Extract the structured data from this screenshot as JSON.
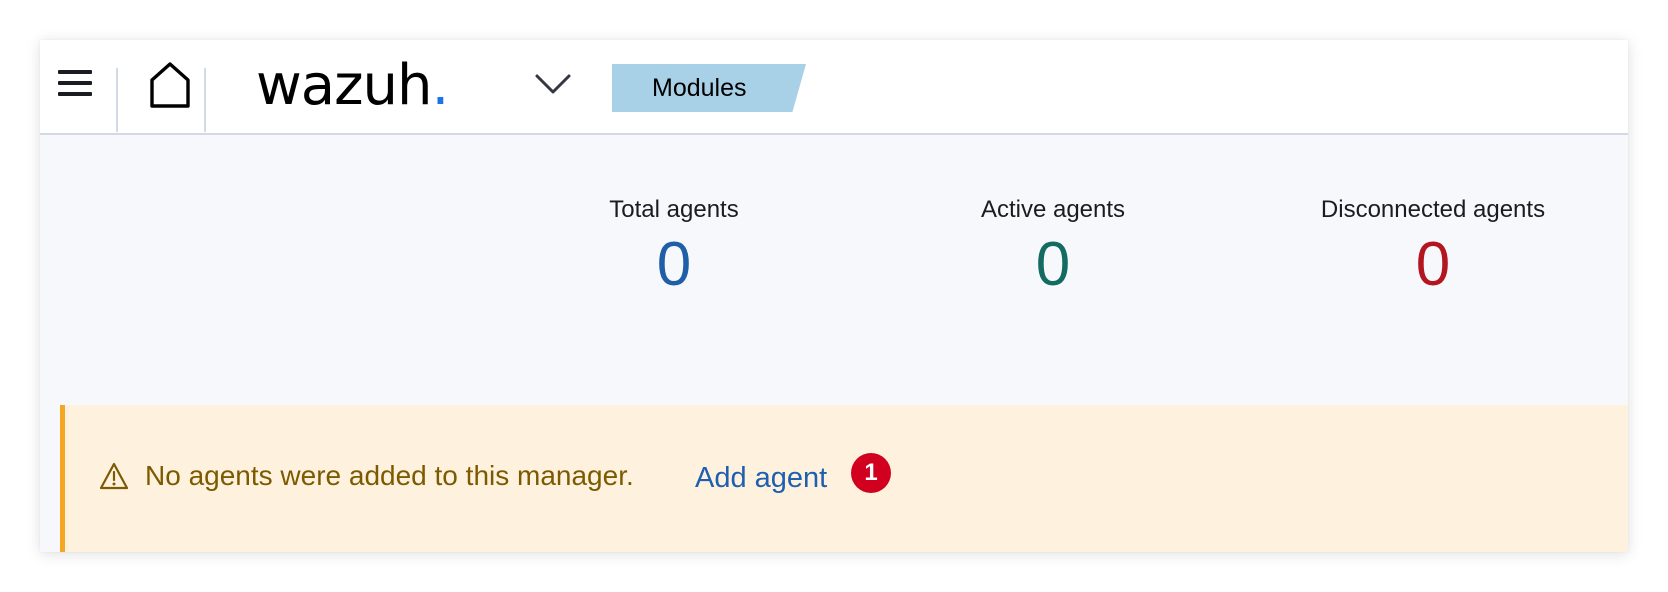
{
  "header": {
    "logo_text": "wazuh",
    "logo_dot": ".",
    "logo_dot_color": "#1a73e8",
    "breadcrumb": "Modules",
    "breadcrumb_color": "#a8d0e6",
    "icons": [
      "menu-icon",
      "home-icon",
      "chevron-down-icon"
    ]
  },
  "stats": [
    {
      "label": "Total agents",
      "value": "0",
      "color": "#1f5fa8"
    },
    {
      "label": "Active agents",
      "value": "0",
      "color": "#136b61"
    },
    {
      "label": "Disconnected agents",
      "value": "0",
      "color": "#b3161e"
    }
  ],
  "callout": {
    "icon": "warning-icon",
    "message": "No agents were added to this manager.",
    "link": "Add agent",
    "badge": "1",
    "background": "#fef2df",
    "border_color": "#f5a623"
  }
}
